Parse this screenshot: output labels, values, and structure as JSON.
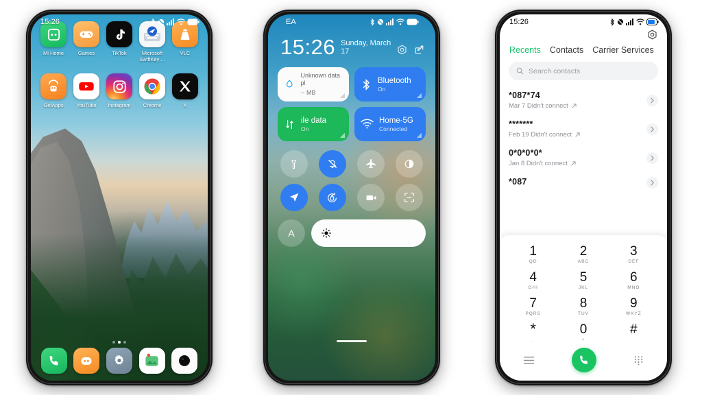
{
  "phone1": {
    "name": "home-screen",
    "status": {
      "time": "15:26",
      "icons": [
        "bluetooth-icon",
        "dnd-mute-icon",
        "signal-bars-icon",
        "wifi-icon",
        "battery-icon"
      ]
    },
    "apps_row1": [
      {
        "label": "Mi Home",
        "icon": "mi-home-icon"
      },
      {
        "label": "Games",
        "icon": "games-icon"
      },
      {
        "label": "TikTok",
        "icon": "tiktok-icon"
      },
      {
        "label": "Microsoft SwiftKey ...",
        "icon": "microsoft-swiftkey-icon"
      },
      {
        "label": "VLC",
        "icon": "vlc-icon"
      }
    ],
    "apps_row2": [
      {
        "label": "GetApps",
        "icon": "getapps-icon"
      },
      {
        "label": "YouTube",
        "icon": "youtube-icon"
      },
      {
        "label": "Instagram",
        "icon": "instagram-icon"
      },
      {
        "label": "Chrome",
        "icon": "chrome-icon"
      },
      {
        "label": "X",
        "icon": "x-twitter-icon"
      }
    ],
    "dock": [
      {
        "label": "Phone",
        "icon": "phone-icon"
      },
      {
        "label": "Mi Browser",
        "icon": "browser-icon"
      },
      {
        "label": "Settings",
        "icon": "gear-icon"
      },
      {
        "label": "Gallery",
        "icon": "gallery-icon"
      },
      {
        "label": "Camera",
        "icon": "camera-icon"
      }
    ],
    "page_dots": 3,
    "active_dot": 1
  },
  "phone2": {
    "name": "control-center",
    "status": {
      "carrier": "EA",
      "icons": [
        "bluetooth-icon",
        "dnd-mute-icon",
        "signal-bars-icon",
        "wifi-icon",
        "battery-icon"
      ]
    },
    "clock": "15:26",
    "date": "Sunday, March 17",
    "header_actions": [
      "settings-gear-icon",
      "edit-icon"
    ],
    "tiles": [
      {
        "title": "Unknown data pl",
        "sub": "-- MB",
        "state": "off",
        "icon": "data-usage-icon",
        "style": "white"
      },
      {
        "title": "Bluetooth",
        "sub": "On",
        "state": "on",
        "icon": "bluetooth-icon",
        "style": "blue"
      },
      {
        "title": "ile data",
        "sub": "On",
        "state": "on",
        "icon": "mobile-data-icon",
        "style": "green"
      },
      {
        "title": "Home-5G",
        "sub": "Connected",
        "state": "on",
        "icon": "wifi-icon",
        "style": "blue"
      }
    ],
    "toggles": [
      {
        "name": "flashlight-icon",
        "on": false
      },
      {
        "name": "mute-bell-icon",
        "on": true
      },
      {
        "name": "airplane-icon",
        "on": false
      },
      {
        "name": "dark-mode-icon",
        "on": false
      },
      {
        "name": "location-icon",
        "on": true
      },
      {
        "name": "auto-rotate-icon",
        "on": true
      },
      {
        "name": "screen-record-icon",
        "on": false
      },
      {
        "name": "screenshot-icon",
        "on": false
      }
    ],
    "auto_brightness_label": "A",
    "brightness_icon": "sun-icon"
  },
  "phone3": {
    "name": "dialer-app",
    "status": {
      "time": "15:26",
      "icons": [
        "bluetooth-icon",
        "dnd-mute-icon",
        "signal-bars-icon",
        "wifi-icon",
        "battery-icon"
      ]
    },
    "settings_icon": "gear-icon",
    "tabs": [
      {
        "label": "Recents",
        "active": true
      },
      {
        "label": "Contacts",
        "active": false
      },
      {
        "label": "Carrier Services",
        "active": false
      }
    ],
    "search": {
      "placeholder": "Search contacts",
      "icon": "search-icon"
    },
    "calls": [
      {
        "number": "*087*74",
        "meta": "Mar 7 Didn't connect",
        "direction": "outgoing-arrow-icon"
      },
      {
        "number": "*******",
        "meta": "Feb 19 Didn't connect",
        "direction": "outgoing-arrow-icon"
      },
      {
        "number": "0*0*0*0*",
        "meta": "Jan 8 Didn't connect",
        "direction": "outgoing-arrow-icon"
      },
      {
        "number": "*087",
        "meta": "",
        "direction": "outgoing-arrow-icon"
      }
    ],
    "keypad": [
      {
        "digit": "1",
        "sub": "QD"
      },
      {
        "digit": "2",
        "sub": "ABC"
      },
      {
        "digit": "3",
        "sub": "DEF"
      },
      {
        "digit": "4",
        "sub": "GHI"
      },
      {
        "digit": "5",
        "sub": "JKL"
      },
      {
        "digit": "6",
        "sub": "MNO"
      },
      {
        "digit": "7",
        "sub": "PQRS"
      },
      {
        "digit": "8",
        "sub": "TUV"
      },
      {
        "digit": "9",
        "sub": "WXYZ"
      },
      {
        "digit": "*",
        "sub": ","
      },
      {
        "digit": "0",
        "sub": "+"
      },
      {
        "digit": "#",
        "sub": ""
      }
    ],
    "bottom": {
      "menu_icon": "menu-lines-icon",
      "call_icon": "phone-call-icon",
      "keypad_icon": "dialpad-grid-icon"
    }
  },
  "colors": {
    "accent_green": "#1fc271",
    "call_green": "#1bc463",
    "tile_blue": "#2f7df0",
    "tile_green": "#1db85a",
    "page_bg": "#ffffff"
  }
}
